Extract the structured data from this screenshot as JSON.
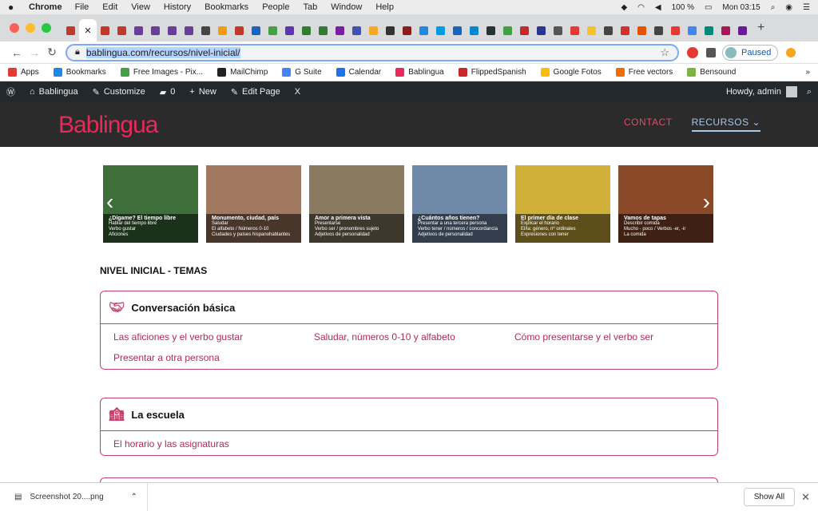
{
  "macbar": {
    "app": "Chrome",
    "menus": [
      "File",
      "Edit",
      "View",
      "History",
      "Bookmarks",
      "People",
      "Tab",
      "Window",
      "Help"
    ],
    "battery": "100 %",
    "clock": "Mon 03:15"
  },
  "tabs": {
    "favicon_colors": [
      "#c0392b",
      "#ffffff",
      "#c0392b",
      "#c0392b",
      "#6a3d9a",
      "#6a3d9a",
      "#6a3d9a",
      "#6a3d9a",
      "#444444",
      "#f39c12",
      "#c0392b",
      "#1565c0",
      "#43a047",
      "#5e35b1",
      "#2e7d32",
      "#2e7d32",
      "#7b1fa2",
      "#3f51b5",
      "#f9a825",
      "#333333",
      "#8e1b1b",
      "#1e88e5",
      "#039be5",
      "#1565c0",
      "#0288d1",
      "#263238",
      "#43a047",
      "#c62828",
      "#283593",
      "#555555",
      "#e53935",
      "#fbc02d",
      "#444444",
      "#d32f2f",
      "#e65100",
      "#444444",
      "#e53935",
      "#4285f4",
      "#00897b",
      "#ad1457",
      "#6a1b9a"
    ],
    "active_close": "✕",
    "new_tab": "+"
  },
  "address": {
    "url": "bablingua.com/recursos/nivel-inicial/",
    "profile_label": "Paused"
  },
  "bookmarks": [
    {
      "label": "Apps",
      "color": "#e53935"
    },
    {
      "label": "Bookmarks",
      "color": "#1e88e5"
    },
    {
      "label": "Free Images - Pix...",
      "color": "#43a047"
    },
    {
      "label": "MailChimp",
      "color": "#222222"
    },
    {
      "label": "G Suite",
      "color": "#4285f4"
    },
    {
      "label": "Calendar",
      "color": "#1a73e8"
    },
    {
      "label": "Bablingua",
      "color": "#e8295a"
    },
    {
      "label": "FlippedSpanish",
      "color": "#c62828"
    },
    {
      "label": "Google Fotos",
      "color": "#fbbc05"
    },
    {
      "label": "Free vectors",
      "color": "#ef6c00"
    },
    {
      "label": "Bensound",
      "color": "#7cb342"
    }
  ],
  "wpbar": {
    "site": "Bablingua",
    "customize": "Customize",
    "comments": "0",
    "new": "New",
    "edit": "Edit Page",
    "x": "X",
    "howdy": "Howdy, admin"
  },
  "site": {
    "logo": "Bablingua",
    "nav_contact": "CONTACT",
    "nav_recursos": "RECURSOS ⌄"
  },
  "slides": [
    {
      "title": "¿Dígame? El tiempo libre",
      "l1": "Hablar del tiempo libre",
      "l2": "Verbo gustar",
      "l3": "Aficiones",
      "bg": "#3e6e3a"
    },
    {
      "title": "Monumento, ciudad, país",
      "l1": "Saludar",
      "l2": "El alfabeto / Números 0-10",
      "l3": "Ciudades y países hispanohablantes",
      "bg": "#a07860"
    },
    {
      "title": "Amor a primera vista",
      "l1": "Presentarse",
      "l2": "Verbo ser / pronombres sujeto",
      "l3": "Adjetivos de personalidad",
      "bg": "#8a7a60"
    },
    {
      "title": "¿Cuántos años tienen?",
      "l1": "Presentar a una tercera persona",
      "l2": "Verbo tener / números / concordancia",
      "l3": "Adjetivos de personalidad",
      "bg": "#6f8aa8"
    },
    {
      "title": "El primer día de clase",
      "l1": "Explicar el horario",
      "l2": "El/la: género, nº ordinales",
      "l3": "Expresiones con tener",
      "bg": "#d1b03a"
    },
    {
      "title": "Vamos de tapas",
      "l1": "Describir comida",
      "l2": "Mucho - poco / Verbos -er, -ir",
      "l3": "La comida",
      "bg": "#8a4a2a"
    }
  ],
  "section_title": "NIVEL INICIAL - TEMAS",
  "cards": [
    {
      "title": "Conversación básica",
      "links": [
        "Las aficiones y el verbo gustar",
        "Saludar, números 0-10 y alfabeto",
        "Cómo presentarse y el verbo ser",
        "Presentar a otra persona"
      ]
    },
    {
      "title": "La escuela",
      "links": [
        "El horario y las asignaturas"
      ]
    }
  ],
  "download": {
    "file": "Screenshot 20....png",
    "show_all": "Show All"
  }
}
